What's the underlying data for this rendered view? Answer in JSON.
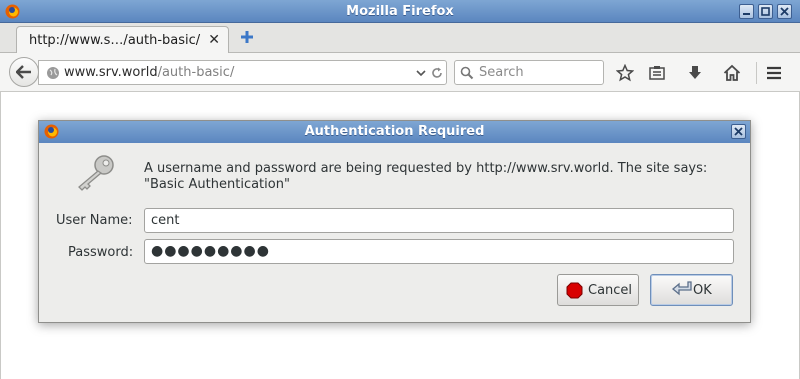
{
  "window": {
    "title": "Mozilla Firefox"
  },
  "tab": {
    "label": "http://www.s…/auth-basic/",
    "close_glyph": "✕"
  },
  "urlbar": {
    "host": "www.srv.world",
    "path": "/auth-basic/"
  },
  "search": {
    "placeholder": "Search"
  },
  "dialog": {
    "title": "Authentication Required",
    "message_line1": "A username and password are being requested by http://www.srv.world. The site says:",
    "message_line2": "\"Basic Authentication\"",
    "username_label": "User Name:",
    "username_value": "cent",
    "password_label": "Password:",
    "password_value": "●●●●●●●●●",
    "cancel_label": "Cancel",
    "ok_label": "OK"
  },
  "icons": {
    "titlebar": [
      "firefox-logo-icon",
      "minimize-icon",
      "maximize-icon",
      "close-icon"
    ],
    "toolbar": [
      "back-arrow-icon",
      "globe-icon",
      "dropdown-icon",
      "reload-icon",
      "search-icon",
      "bookmark-star-icon",
      "reading-list-icon",
      "download-icon",
      "home-icon",
      "menu-icon"
    ],
    "dialog": [
      "key-icon",
      "stop-icon",
      "return-arrow-icon"
    ]
  },
  "colors": {
    "titlebar": "#6c96c9",
    "dialog_bg": "#ededeb",
    "cancel_stop": "#d80000"
  }
}
